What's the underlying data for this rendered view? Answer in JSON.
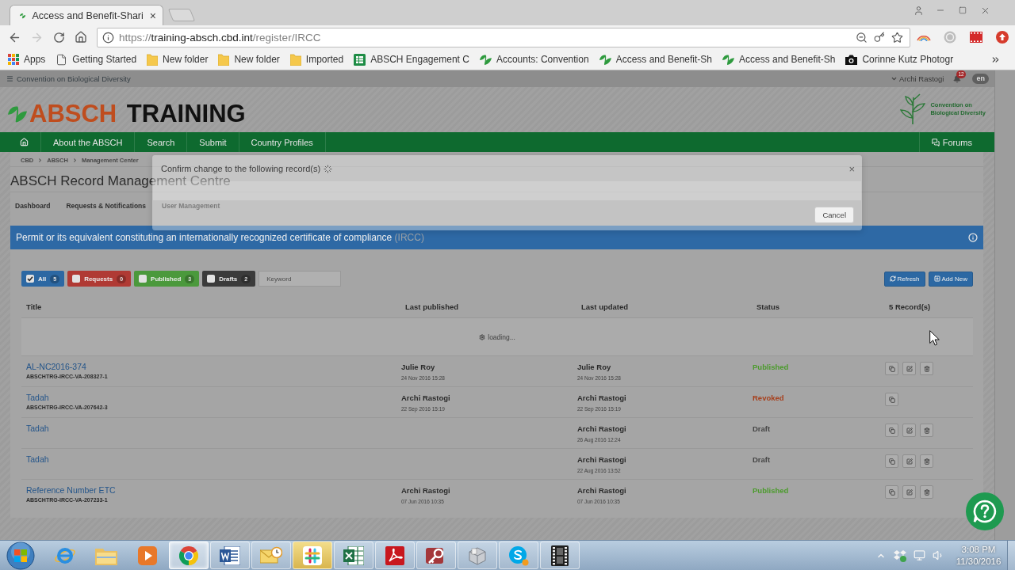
{
  "browser": {
    "tab": {
      "title": "Access and Benefit-Shari",
      "close": "×"
    },
    "buttons": [
      {
        "kind": "back",
        "disabled": false
      },
      {
        "kind": "forward",
        "disabled": true
      },
      {
        "kind": "reload",
        "disabled": false
      },
      {
        "kind": "home",
        "disabled": false
      }
    ],
    "url": {
      "scheme": "https://",
      "host": "training-absch.cbd.int",
      "path": "/register/IRCC"
    },
    "bookmarks": [
      {
        "kind": "apps",
        "label": "Apps"
      },
      {
        "kind": "page",
        "label": "Getting Started"
      },
      {
        "kind": "folder",
        "label": "New folder"
      },
      {
        "kind": "folder",
        "label": "New folder"
      },
      {
        "kind": "folder",
        "label": "Imported"
      },
      {
        "kind": "sheet",
        "label": "ABSCH Engagement C"
      },
      {
        "kind": "leaf",
        "label": "Accounts: Convention"
      },
      {
        "kind": "leaf",
        "label": "Access and Benefit-Sh"
      },
      {
        "kind": "leaf",
        "label": "Access and Benefit-Sh"
      },
      {
        "kind": "camera",
        "label": "Corinne Kutz Photogr"
      }
    ]
  },
  "site_bar": {
    "org": "Convention on Biological Diversity",
    "user": "Archi Rastogi",
    "notifications": "12",
    "language": "en"
  },
  "header": {
    "logo_accent": "ABSCH",
    "logo_rest": "TRAINING",
    "partner": [
      "Convention on",
      "Biological Diversity"
    ]
  },
  "nav": {
    "items": [
      "About the ABSCH",
      "Search",
      "Submit",
      "Country Profiles"
    ],
    "forums": "Forums"
  },
  "breadcrumb": [
    "CBD",
    "ABSCH",
    "Management Center"
  ],
  "page_title": "ABSCH Record Management Centre",
  "tabs": [
    "Dashboard",
    "Requests & Notifications",
    "User Management"
  ],
  "section": {
    "title": "Permit or its equivalent constituting an internationally recognized certificate of compliance",
    "code": "(IRCC)"
  },
  "filters": [
    {
      "label": "All",
      "count": "5",
      "checked": true,
      "color": "#2c68a3"
    },
    {
      "label": "Requests",
      "count": "0",
      "checked": false,
      "color": "#b03a34"
    },
    {
      "label": "Published",
      "count": "3",
      "checked": false,
      "color": "#4b993c"
    },
    {
      "label": "Drafts",
      "count": "2",
      "checked": false,
      "color": "#3b3b3b"
    }
  ],
  "search": {
    "placeholder": "Keyword"
  },
  "toolbar": [
    {
      "kind": "refresh",
      "label": "Refresh"
    },
    {
      "kind": "add",
      "label": "Add New"
    }
  ],
  "table": {
    "columns": [
      "Title",
      "Last published",
      "Last updated",
      "Status",
      "5 Record(s)"
    ],
    "loading": "loading...",
    "rows": [
      {
        "title": "AL-NC2016-374",
        "reference": "ABSCHTRG-IRCC-VA-208327-1",
        "published": {
          "name": "Julie Roy",
          "date": "24 Nov 2016 15:28"
        },
        "updated": {
          "name": "Julie Roy",
          "date": "24 Nov 2016 15:28"
        },
        "status": {
          "label": "Published",
          "color": "#4c9b2d"
        },
        "actions": [
          {
            "kind": "copy"
          },
          {
            "kind": "edit"
          },
          {
            "kind": "delete"
          }
        ]
      },
      {
        "title": "Tadah",
        "reference": "ABSCHTRG-IRCC-VA-207642-3",
        "published": {
          "name": "Archi Rastogi",
          "date": "22 Sep 2016 15:19"
        },
        "updated": {
          "name": "Archi Rastogi",
          "date": "22 Sep 2016 15:19"
        },
        "status": {
          "label": "Revoked",
          "color": "#a7401d"
        },
        "actions": [
          {
            "kind": "copy"
          }
        ]
      },
      {
        "title": "Tadah",
        "updated": {
          "name": "Archi Rastogi",
          "date": "26 Aug 2016 12:24"
        },
        "status": {
          "label": "Draft",
          "color": "#454545"
        },
        "actions": [
          {
            "kind": "copy"
          },
          {
            "kind": "edit"
          },
          {
            "kind": "delete"
          }
        ]
      },
      {
        "title": "Tadah",
        "updated": {
          "name": "Archi Rastogi",
          "date": "22 Aug 2016 13:52"
        },
        "status": {
          "label": "Draft",
          "color": "#454545"
        },
        "actions": [
          {
            "kind": "copy"
          },
          {
            "kind": "edit"
          },
          {
            "kind": "delete"
          }
        ]
      },
      {
        "title": "Reference Number ETC",
        "reference": "ABSCHTRG-IRCC-VA-207233-1",
        "published": {
          "name": "Archi Rastogi",
          "date": "07 Jun 2016 10:35"
        },
        "updated": {
          "name": "Archi Rastogi",
          "date": "07 Jun 2016 10:35"
        },
        "status": {
          "label": "Published",
          "color": "#4c9b2d"
        },
        "actions": [
          {
            "kind": "copy"
          },
          {
            "kind": "edit"
          },
          {
            "kind": "delete"
          }
        ]
      }
    ]
  },
  "modal": {
    "title": "Confirm change to the following record(s)",
    "close": "×",
    "buttons": [
      "Cancel"
    ]
  },
  "taskbar": {
    "apps": [
      {
        "kind": "ie",
        "running": false,
        "selected": false,
        "flashing": false
      },
      {
        "kind": "explorer",
        "running": false,
        "selected": false,
        "flashing": false
      },
      {
        "kind": "media",
        "running": false,
        "selected": false,
        "flashing": false
      },
      {
        "kind": "chrome",
        "running": true,
        "selected": true,
        "flashing": false
      },
      {
        "kind": "word",
        "running": true,
        "selected": false,
        "flashing": false
      },
      {
        "kind": "outlook",
        "running": true,
        "selected": false,
        "flashing": false
      },
      {
        "kind": "slack",
        "running": true,
        "selected": false,
        "flashing": true
      },
      {
        "kind": "excel",
        "running": true,
        "selected": false,
        "flashing": false
      },
      {
        "kind": "acrobat",
        "running": true,
        "selected": false,
        "flashing": false
      },
      {
        "kind": "access",
        "running": true,
        "selected": false,
        "flashing": false
      },
      {
        "kind": "box",
        "running": true,
        "selected": false,
        "flashing": false
      },
      {
        "kind": "skype",
        "running": true,
        "selected": false,
        "flashing": false
      },
      {
        "kind": "film",
        "running": true,
        "selected": false,
        "flashing": false
      }
    ],
    "time": "3:08 PM",
    "date": "11/30/2016"
  }
}
